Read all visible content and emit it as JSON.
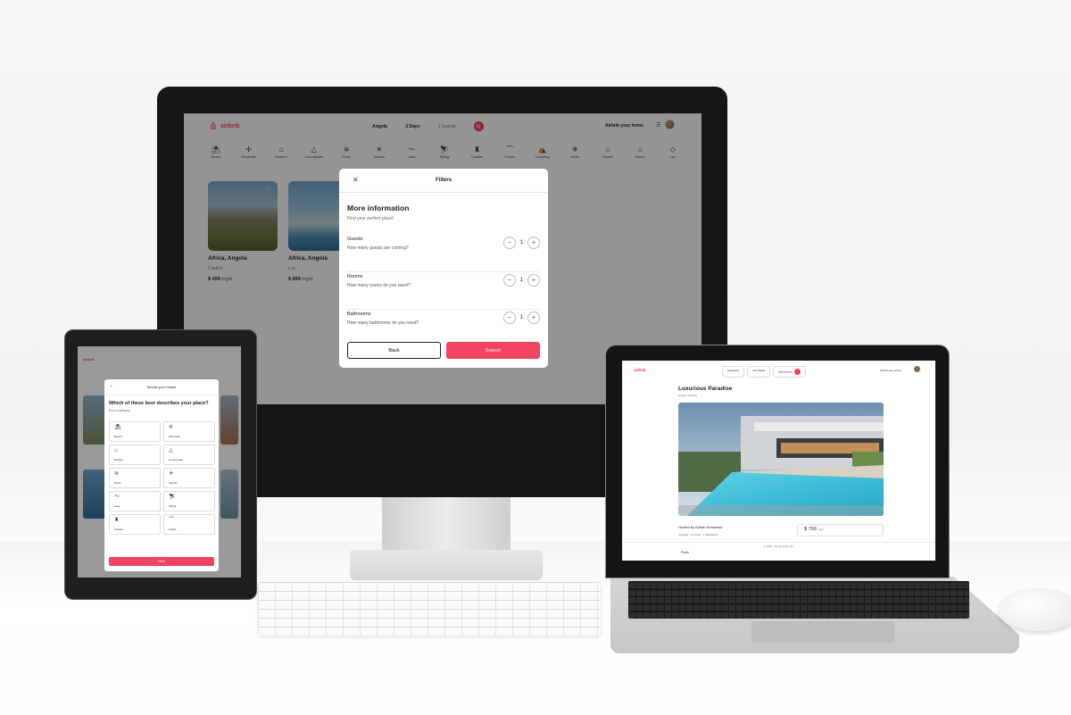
{
  "colors": {
    "brand": "#ff385c",
    "search_button": "#f14462"
  },
  "desktop": {
    "logo": "airbnb",
    "search": {
      "location": "Angola",
      "dates": "3 Days",
      "guests": "1 Guests"
    },
    "host_link": "Airbnb your home",
    "categories": [
      {
        "icon": "beach-icon",
        "label": "Beach"
      },
      {
        "icon": "windmill-icon",
        "label": "Windmills"
      },
      {
        "icon": "modern-icon",
        "label": "Modern"
      },
      {
        "icon": "countryside-icon",
        "label": "Countryside"
      },
      {
        "icon": "pool-icon",
        "label": "Pools"
      },
      {
        "icon": "island-icon",
        "label": "Islands"
      },
      {
        "icon": "lake-icon",
        "label": "Lake"
      },
      {
        "icon": "skiing-icon",
        "label": "Skiing"
      },
      {
        "icon": "castle-icon",
        "label": "Castles"
      },
      {
        "icon": "cave-icon",
        "label": "Caves"
      },
      {
        "icon": "camping-icon",
        "label": "Camping"
      },
      {
        "icon": "arctic-icon",
        "label": "Arctic"
      },
      {
        "icon": "desert-icon",
        "label": "Desert"
      },
      {
        "icon": "barn-icon",
        "label": "Barns"
      },
      {
        "icon": "lux-icon",
        "label": "Lux"
      }
    ],
    "listings": [
      {
        "location": "Africa, Angola",
        "category": "Castles",
        "price": "$ 499",
        "per": "night"
      },
      {
        "location": "Africa, Angola",
        "category": "Lux",
        "price": "$ 899",
        "per": "night"
      }
    ],
    "filters_modal": {
      "title": "Filters",
      "heading": "More information",
      "subheading": "Find your perfect place!",
      "rows": [
        {
          "label": "Guests",
          "question": "How many guests are coming?",
          "value": "1"
        },
        {
          "label": "Rooms",
          "question": "How many rooms do you need?",
          "value": "1"
        },
        {
          "label": "Bathrooms",
          "question": "How many bahtrooms do you need?",
          "value": "1"
        }
      ],
      "back_label": "Back",
      "search_label": "Search"
    }
  },
  "tablet": {
    "logo": "airbnb",
    "modal": {
      "title": "Airbnb your home!",
      "heading": "Which of these best describes your place?",
      "subheading": "Pick a category",
      "tiles": [
        {
          "icon": "beach-icon",
          "label": "Beach"
        },
        {
          "icon": "windmill-icon",
          "label": "Windmills"
        },
        {
          "icon": "modern-icon",
          "label": "Modern"
        },
        {
          "icon": "countryside-icon",
          "label": "Countryside"
        },
        {
          "icon": "pool-icon",
          "label": "Pools"
        },
        {
          "icon": "island-icon",
          "label": "Islands"
        },
        {
          "icon": "lake-icon",
          "label": "Lake"
        },
        {
          "icon": "skiing-icon",
          "label": "Skiing"
        },
        {
          "icon": "castle-icon",
          "label": "Castles"
        },
        {
          "icon": "cave-icon",
          "label": "Caves"
        }
      ],
      "next_label": "Next"
    }
  },
  "laptop": {
    "logo": "airbnb",
    "search": {
      "location": "Anywhere",
      "dates": "Any Week",
      "guests": "Add Guests"
    },
    "host_link": "Airbnb your home",
    "listing": {
      "title": "Luxurious Paradise",
      "location": "Europe, Albania",
      "hosted_by": "Hosted by Adrian Domański",
      "meta": "3 guests · 2 rooms · 1 bathrooms",
      "price": "$ 799",
      "per": "night"
    },
    "footer": "© 2023 · Adrian Nest, Inc.",
    "bottom_item": "Pools"
  }
}
